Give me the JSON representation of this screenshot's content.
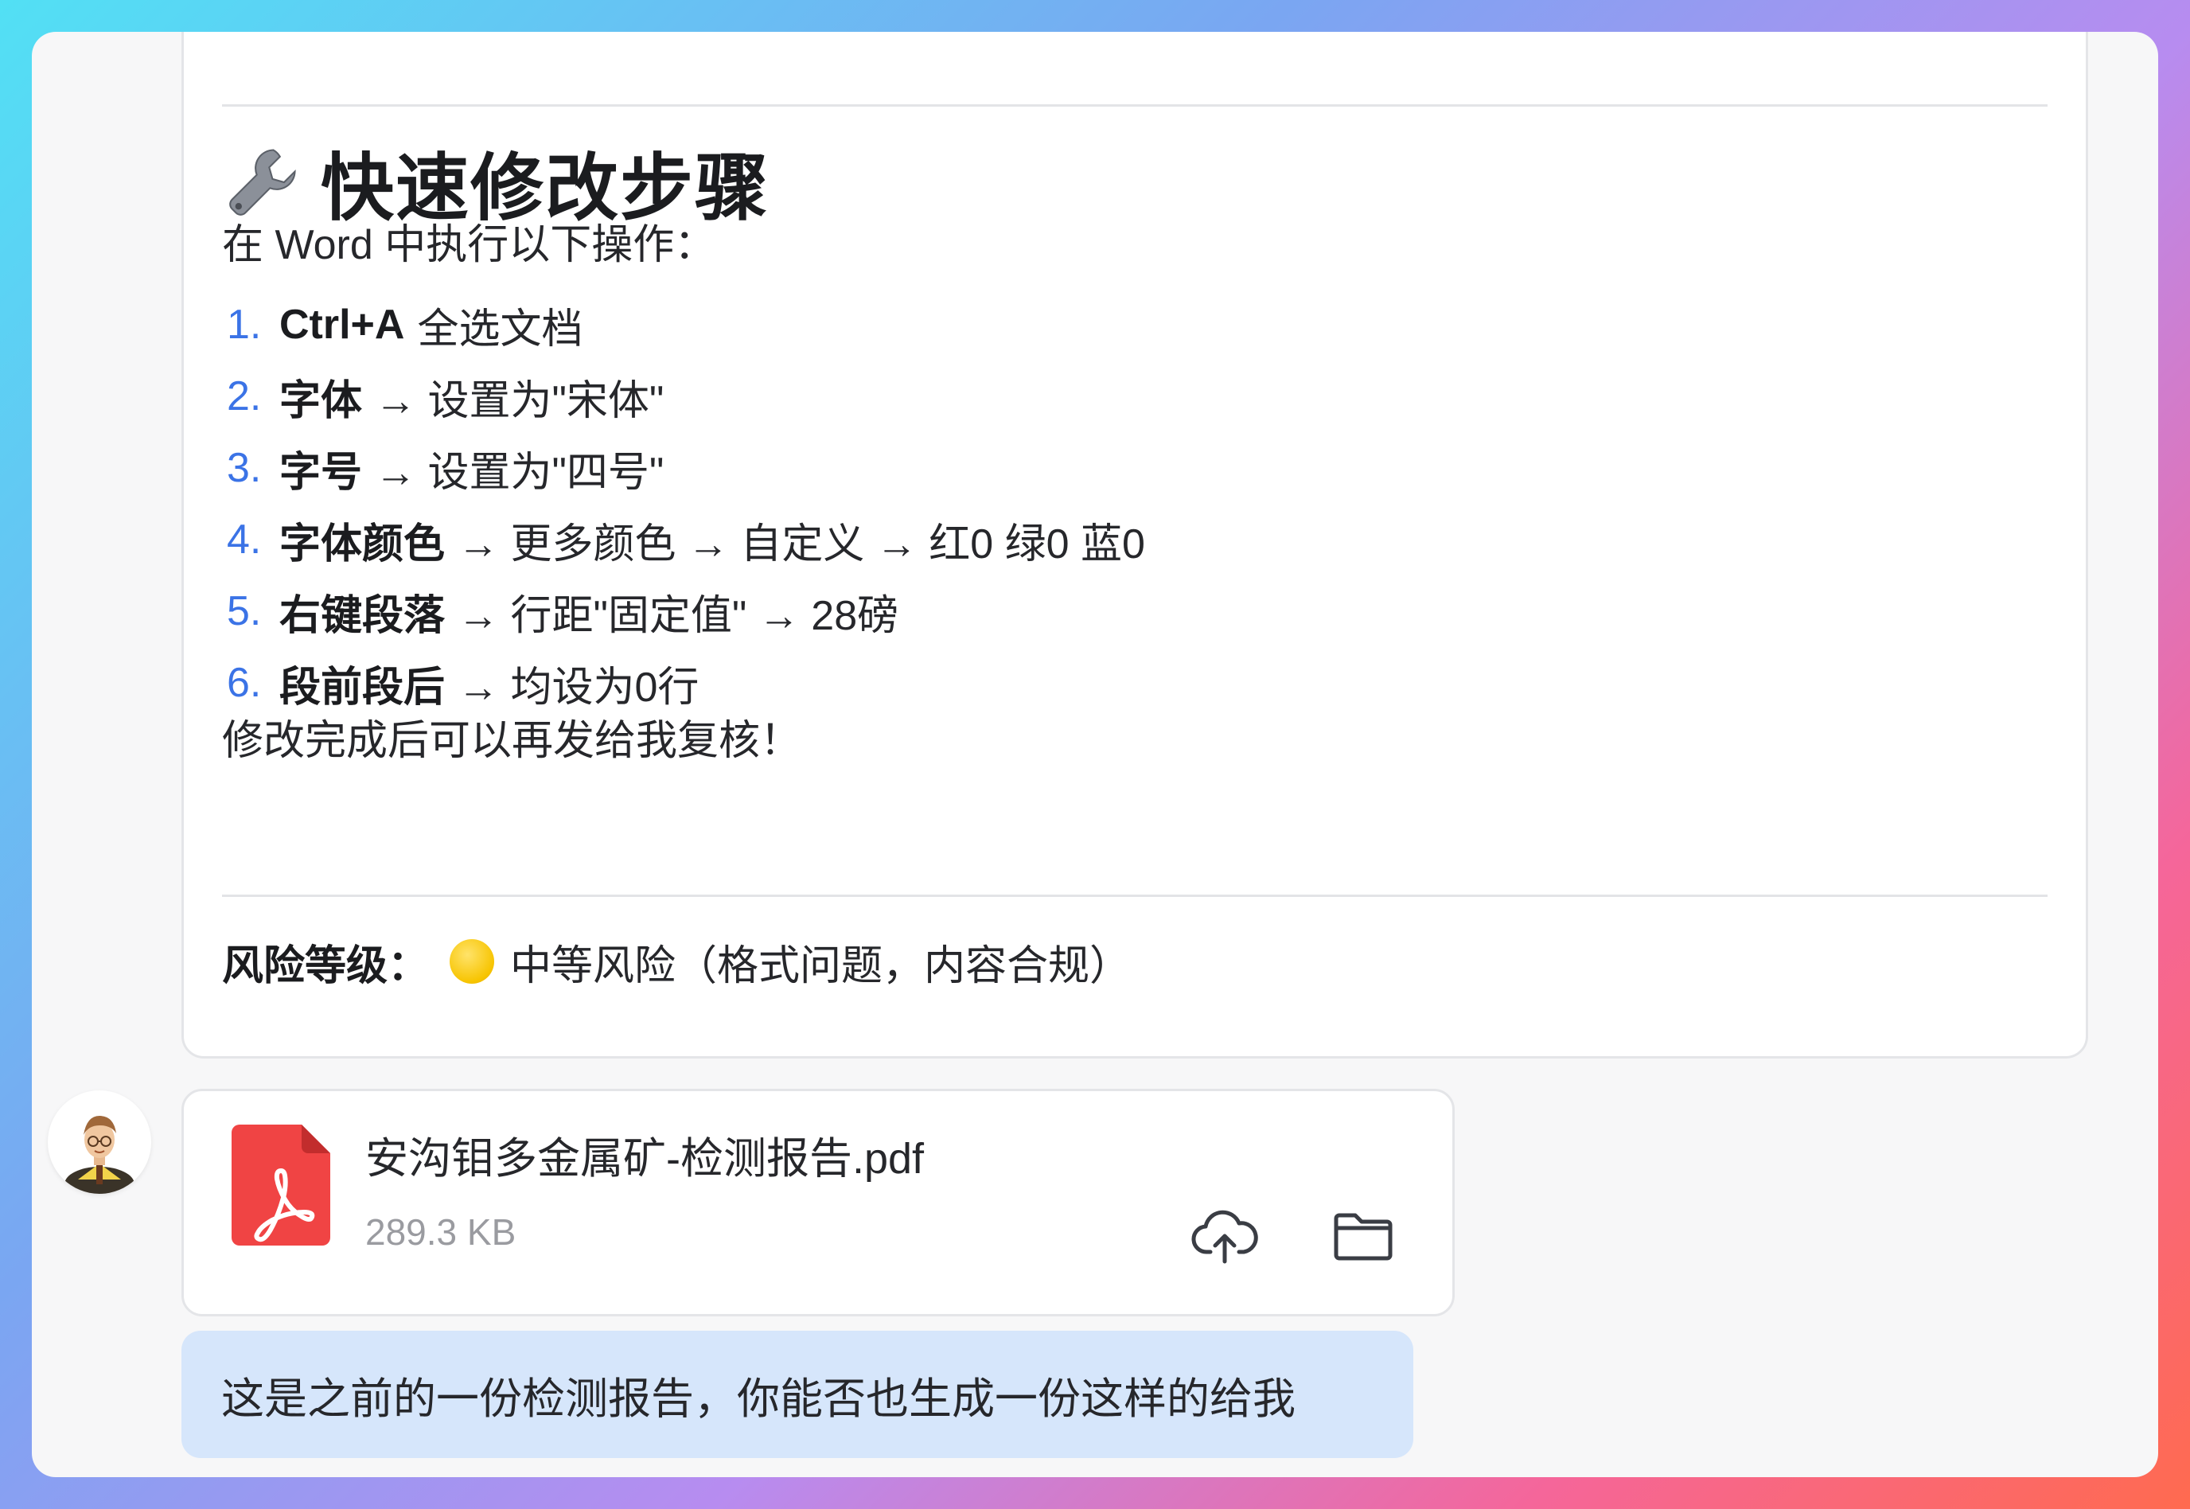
{
  "reply": {
    "heading": "快速修改步骤",
    "heading_icon": "wrench-icon",
    "intro": "在 Word 中执行以下操作：",
    "steps": [
      {
        "num": "1.",
        "key": "Ctrl+A",
        "rest": "全选文档"
      },
      {
        "num": "2.",
        "key": "字体",
        "rest": "→ 设置为\"宋体\""
      },
      {
        "num": "3.",
        "key": "字号",
        "rest": "→ 设置为\"四号\""
      },
      {
        "num": "4.",
        "key": "字体颜色",
        "rest": "→ 更多颜色 → 自定义 → 红0 绿0 蓝0"
      },
      {
        "num": "5.",
        "key": "右键段落",
        "rest": "→ 行距\"固定值\" → 28磅"
      },
      {
        "num": "6.",
        "key": "段前段后",
        "rest": "→ 均设为0行"
      }
    ],
    "closing": "修改完成后可以再发给我复核！",
    "risk_label": "风险等级：",
    "risk_value": "中等风险（格式问题，内容合规）",
    "risk_color": "#f7c400"
  },
  "file": {
    "name": "安沟钼多金属矿-检测报告.pdf",
    "size": "289.3 KB",
    "icon": "pdf-file-icon",
    "icon_color": "#f04444"
  },
  "user_message": "这是之前的一份检测报告，你能否也生成一份这样的给我",
  "colors": {
    "accent_number": "#3b73e6",
    "bubble": "#d6e6fb"
  }
}
